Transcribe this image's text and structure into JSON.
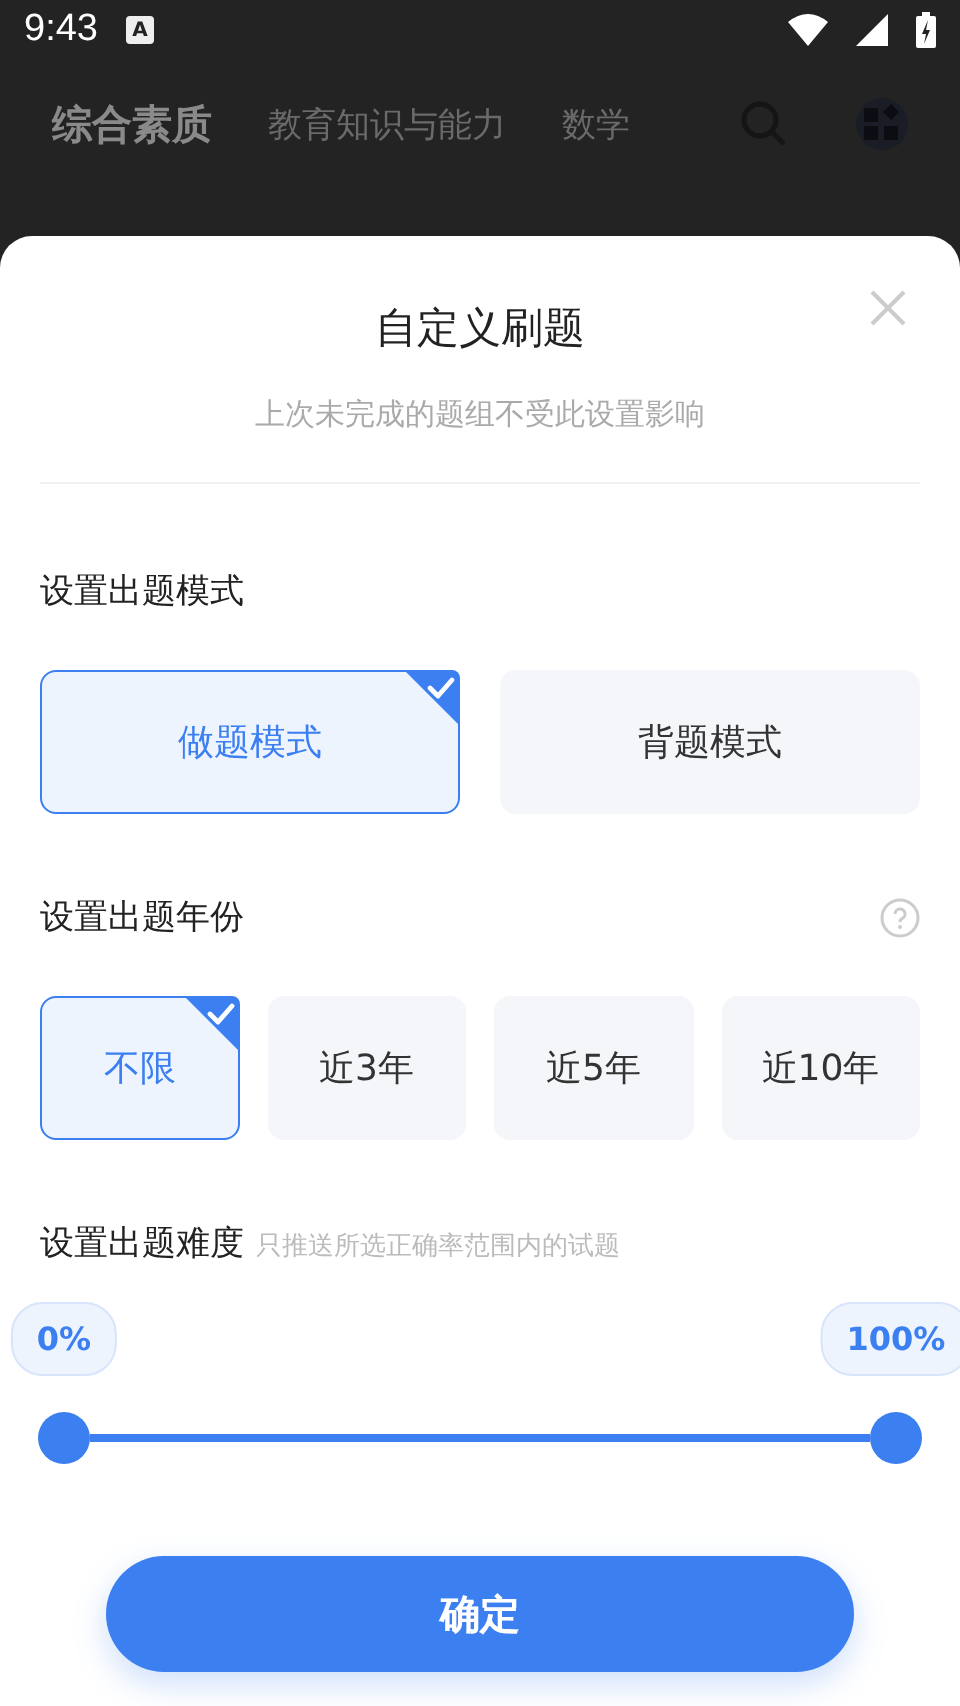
{
  "status_bar": {
    "time": "9:43",
    "notification": "A"
  },
  "header_tabs": [
    {
      "label": "综合素质",
      "selected": true
    },
    {
      "label": "教育知识与能力",
      "selected": false
    },
    {
      "label": "数学",
      "selected": false
    }
  ],
  "sheet": {
    "title": "自定义刷题",
    "subtitle": "上次未完成的题组不受此设置影响",
    "mode_section": {
      "label": "设置出题模式",
      "options": [
        {
          "label": "做题模式",
          "selected": true
        },
        {
          "label": "背题模式",
          "selected": false
        }
      ]
    },
    "year_section": {
      "label": "设置出题年份",
      "options": [
        {
          "label": "不限",
          "selected": true
        },
        {
          "label": "近3年",
          "selected": false
        },
        {
          "label": "近5年",
          "selected": false
        },
        {
          "label": "近10年",
          "selected": false
        }
      ]
    },
    "difficulty_section": {
      "label": "设置出题难度",
      "hint": "只推送所选正确率范围内的试题",
      "low": {
        "reading": "0%",
        "level": 0
      },
      "high": {
        "reading": "100%",
        "level": 1
      }
    },
    "confirm_button": "确定"
  }
}
